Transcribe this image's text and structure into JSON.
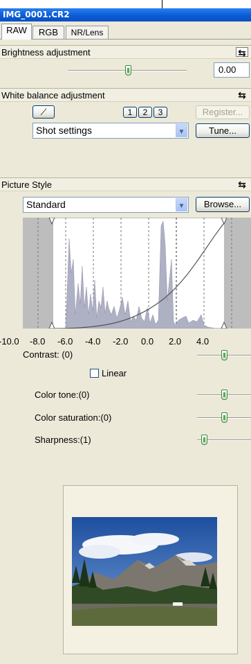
{
  "window": {
    "title": "IMG_0001.CR2"
  },
  "tabs": [
    {
      "label": "RAW",
      "active": true
    },
    {
      "label": "RGB",
      "active": false
    },
    {
      "label": "NR/Lens",
      "active": false
    }
  ],
  "brightness": {
    "title": "Brightness adjustment",
    "value": "0.00"
  },
  "white_balance": {
    "title": "White balance adjustment",
    "preset_buttons": [
      "1",
      "2",
      "3"
    ],
    "register_label": "Register...",
    "selected_option": "Shot settings",
    "tune_label": "Tune..."
  },
  "picture_style": {
    "title": "Picture Style",
    "selected_option": "Standard",
    "browse_label": "Browse...",
    "tick_labels": [
      "-10.0",
      "-8.0",
      "-6.0",
      "-4.0",
      "-2.0",
      "0.0",
      "2.0",
      "4.0"
    ],
    "contrast_label": "Contrast: (0)",
    "contrast_level": 0,
    "linear_label": "Linear",
    "linear_checked": false,
    "color_tone_label": "Color tone:(0)",
    "color_tone_level": 0,
    "color_saturation_label": "Color saturation:(0)",
    "color_saturation_level": 0,
    "sharpness_label": "Sharpness:(1)",
    "sharpness_level": 1
  },
  "colors": {
    "titlebar": "#0a5bd6",
    "panel": "#ece9d8",
    "thumb_green": "#4db24d",
    "histogram": "#aeb0c4"
  }
}
